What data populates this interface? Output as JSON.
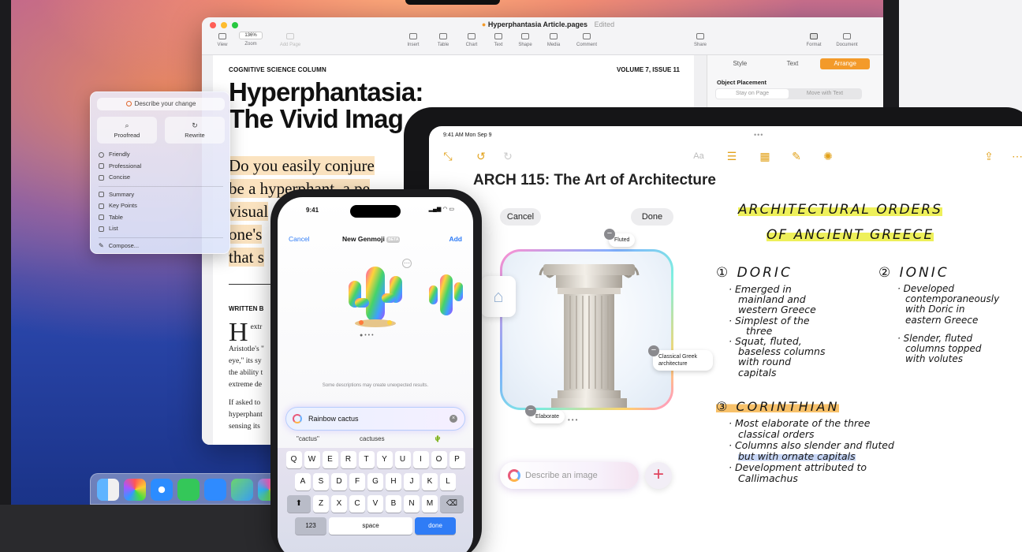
{
  "mac": {
    "pages": {
      "doc_title": "Hyperphantasia Article.pages",
      "edited": "Edited",
      "toolbar": {
        "view": "View",
        "zoom_value": "136%",
        "zoom": "Zoom",
        "add_page": "Add Page",
        "insert": "Insert",
        "table": "Table",
        "chart": "Chart",
        "text": "Text",
        "shape": "Shape",
        "media": "Media",
        "comment": "Comment",
        "share": "Share",
        "format": "Format",
        "document": "Document"
      },
      "column_head": "COGNITIVE SCIENCE COLUMN",
      "volume": "VOLUME 7, ISSUE 11",
      "headline_1": "Hyperphantasia:",
      "headline_2": "The Vivid Imag",
      "lede": [
        "Do you easily conjure",
        "be a hyperphant, a pe",
        "visual",
        "one's",
        "that s"
      ],
      "written_by": "WRITTEN B",
      "body": [
        "H",
        "extr",
        "Aristotle's \"",
        "eye,\" its sy",
        "the ability t",
        "extreme de",
        "",
        "If asked to",
        "hyperphant",
        "sensing its"
      ],
      "sidebar": {
        "tabs": [
          "Style",
          "Text",
          "Arrange"
        ],
        "object_placement": "Object Placement",
        "placement_options": [
          "Stay on Page",
          "Move with Text"
        ]
      }
    },
    "writing_tools": {
      "describe": "Describe your change",
      "proofread": "Proofread",
      "rewrite": "Rewrite",
      "tones": [
        "Friendly",
        "Professional",
        "Concise"
      ],
      "formats": [
        "Summary",
        "Key Points",
        "Table",
        "List"
      ],
      "compose": "Compose..."
    }
  },
  "ipad": {
    "status_time": "9:41 AM  Mon Sep 9",
    "note_title": "ARCH 115: The Art of Architecture",
    "cancel": "Cancel",
    "done": "Done",
    "tags": {
      "fluted": "Fluted",
      "classical": "Classical Greek architecture",
      "elaborate": "Elaborate"
    },
    "describe_placeholder": "Describe an image",
    "handwriting": {
      "title_1": "ARCHITECTURAL ORDERS",
      "title_2": "OF ANCIENT GREECE",
      "doric_head": "① DORIC",
      "doric_lines": [
        "· Emerged in",
        "mainland and",
        "western Greece",
        "· Simplest of the",
        "three",
        "· Squat, fluted,",
        "baseless columns",
        "with round",
        "capitals"
      ],
      "ionic_head": "② IONIC",
      "ionic_lines": [
        "· Developed",
        "contemporaneously",
        "with Doric in",
        "eastern Greece",
        "· Slender, fluted",
        "columns topped",
        "with volutes"
      ],
      "corinthian_head": "③ CORINTHIAN",
      "corinthian_lines": [
        "· Most elaborate of the three",
        "classical orders",
        "· Columns also slender and fluted",
        "but with ornate capitals",
        "· Development attributed to",
        "Callimachus"
      ]
    }
  },
  "iphone": {
    "time": "9:41",
    "cancel": "Cancel",
    "title": "New Genmoji",
    "beta": "BETA",
    "add": "Add",
    "warning": "Some descriptions may create unexpected results.",
    "input_value": "Rainbow cactus",
    "suggestions": [
      "\"cactus\"",
      "cactuses",
      "🌵"
    ],
    "keyboard": {
      "row1": [
        "Q",
        "W",
        "E",
        "R",
        "T",
        "Y",
        "U",
        "I",
        "O",
        "P"
      ],
      "row2": [
        "A",
        "S",
        "D",
        "F",
        "G",
        "H",
        "J",
        "K",
        "L"
      ],
      "row3": [
        "Z",
        "X",
        "C",
        "V",
        "B",
        "N",
        "M"
      ],
      "num": "123",
      "space": "space",
      "done": "done"
    }
  },
  "colors": {
    "accent_orange": "#f39a2a",
    "notes_yellow": "#e2a21b",
    "keyboard_blue": "#2f7cf6"
  }
}
